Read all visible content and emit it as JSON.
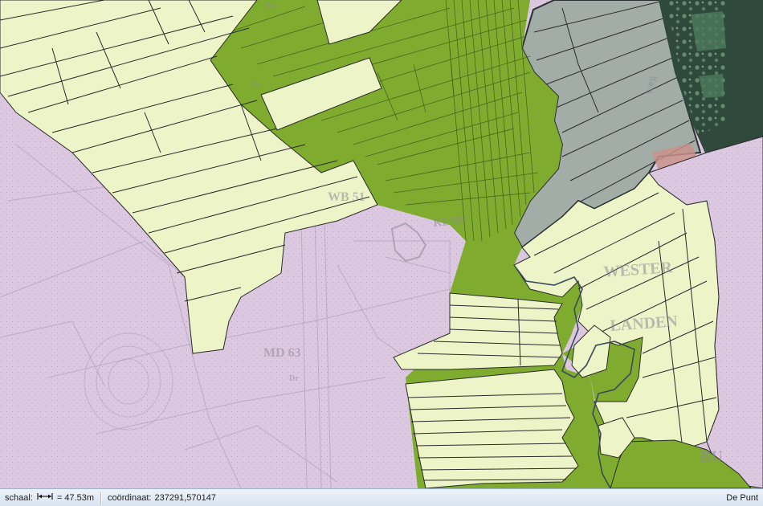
{
  "map": {
    "labels": {
      "wb": "WB 51",
      "md": "MD 63",
      "wester": "WESTER",
      "landen": "LANDEN",
      "bu": "BU",
      "dr1": "Dr",
      "dr2": "Dr",
      "kem": "KEMP",
      "weg": "weg",
      "bm": "Bm"
    },
    "colors": {
      "background_purple": "#dcc8e0",
      "light_green": "#ecf4c8",
      "dark_green": "#7fac2f",
      "grey_parcel": "#9fa9a4",
      "forest": "#2f4a3c",
      "forest_light": "#4e7a5c",
      "parcel_line": "#2a2a2a"
    }
  },
  "statusbar": {
    "scale_label": "schaal:",
    "scale_icon": "horizontal-measure-icon",
    "scale_value": "= 47.53m",
    "coordinate_label": "coördinaat:",
    "coordinate_value": "237291,570147",
    "place_name": "De Punt"
  }
}
